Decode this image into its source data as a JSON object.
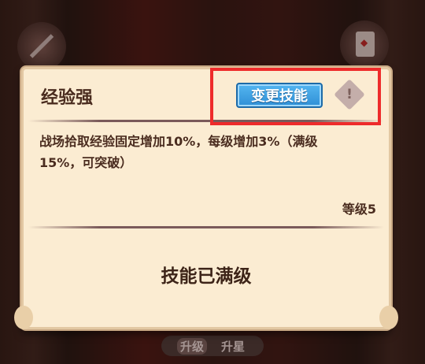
{
  "skill": {
    "name": "经验强",
    "change_label": "变更技能",
    "description": "战场拾取经验固定增加10%，每级增加3%（满级15%，可突破）",
    "level_text": "等级5",
    "max_text": "技能已满级"
  },
  "bottom_tabs": {
    "upgrade": "升级",
    "star_up": "升星"
  },
  "colors": {
    "panel_bg": "#fbecd2",
    "button_blue": "#3a9fe0",
    "highlight_red": "#ee2b2b",
    "text_brown": "#4a2c1f"
  }
}
